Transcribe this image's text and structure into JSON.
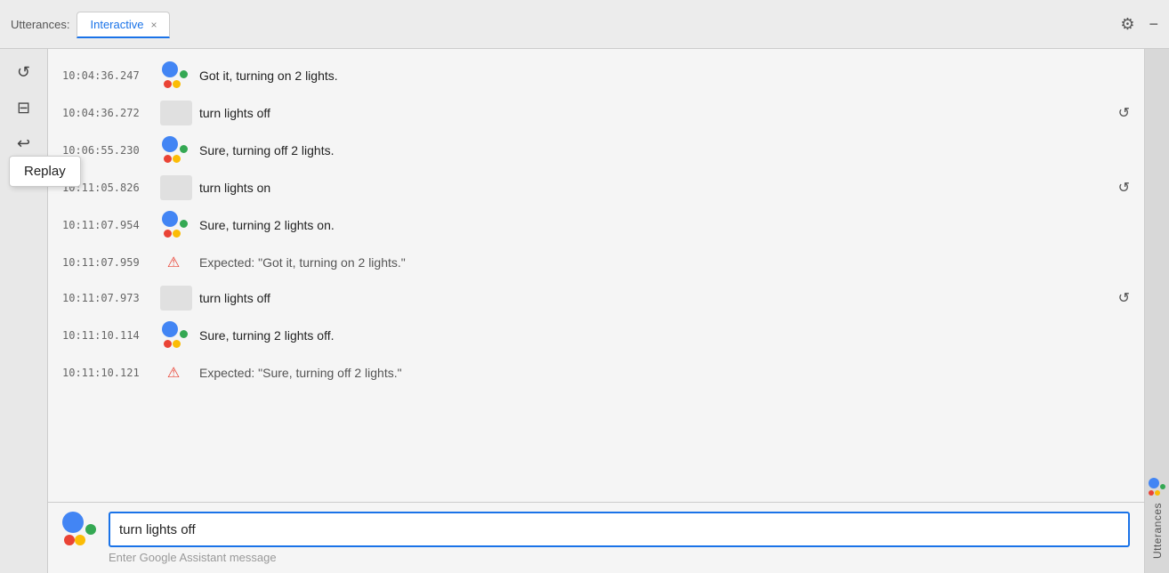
{
  "titleBar": {
    "label": "Utterances:",
    "tab": {
      "name": "Interactive",
      "active": true,
      "closeLabel": "×"
    },
    "gearIcon": "⚙",
    "minimizeIcon": "−"
  },
  "sidebar": {
    "replayIcon": "↺",
    "saveIcon": "⊟",
    "undoIcon": "↩",
    "replayTooltip": "Replay"
  },
  "utterances": [
    {
      "id": 1,
      "timestamp": "10:04:36.247",
      "type": "assistant",
      "text": "Got it, turning on 2 lights."
    },
    {
      "id": 2,
      "timestamp": "10:04:36.272",
      "type": "user",
      "text": "turn lights off",
      "hasReplay": true
    },
    {
      "id": 3,
      "timestamp": "10:06:55.230",
      "type": "assistant",
      "text": "Sure, turning off 2 lights."
    },
    {
      "id": 4,
      "timestamp": "10:11:05.826",
      "type": "user",
      "text": "turn lights on",
      "hasReplay": true
    },
    {
      "id": 5,
      "timestamp": "10:11:07.954",
      "type": "assistant",
      "text": "Sure, turning 2 lights on."
    },
    {
      "id": 6,
      "timestamp": "10:11:07.959",
      "type": "error",
      "text": "Expected: \"Got it, turning on 2 lights.\""
    },
    {
      "id": 7,
      "timestamp": "10:11:07.973",
      "type": "user",
      "text": "turn lights off",
      "hasReplay": true
    },
    {
      "id": 8,
      "timestamp": "10:11:10.114",
      "type": "assistant",
      "text": "Sure, turning 2 lights off."
    },
    {
      "id": 9,
      "timestamp": "10:11:10.121",
      "type": "error",
      "text": "Expected: \"Sure, turning off 2 lights.\""
    }
  ],
  "inputArea": {
    "value": "turn lights off",
    "placeholder": "Enter Google Assistant message",
    "hint": "Enter Google Assistant message"
  },
  "rightSidebar": {
    "label": "Utterances"
  }
}
